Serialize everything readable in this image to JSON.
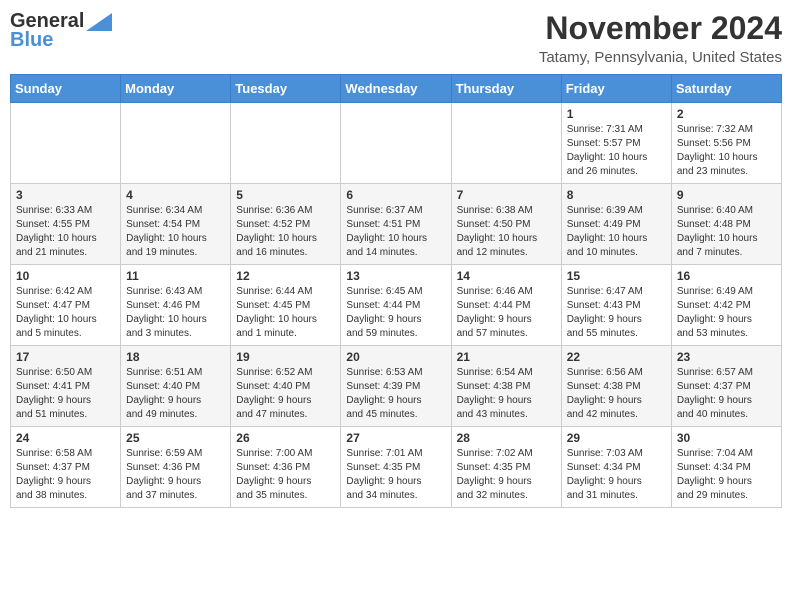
{
  "header": {
    "logo_line1": "General",
    "logo_line2": "Blue",
    "month": "November 2024",
    "location": "Tatamy, Pennsylvania, United States"
  },
  "days_of_week": [
    "Sunday",
    "Monday",
    "Tuesday",
    "Wednesday",
    "Thursday",
    "Friday",
    "Saturday"
  ],
  "weeks": [
    [
      {
        "day": "",
        "info": ""
      },
      {
        "day": "",
        "info": ""
      },
      {
        "day": "",
        "info": ""
      },
      {
        "day": "",
        "info": ""
      },
      {
        "day": "",
        "info": ""
      },
      {
        "day": "1",
        "info": "Sunrise: 7:31 AM\nSunset: 5:57 PM\nDaylight: 10 hours\nand 26 minutes."
      },
      {
        "day": "2",
        "info": "Sunrise: 7:32 AM\nSunset: 5:56 PM\nDaylight: 10 hours\nand 23 minutes."
      }
    ],
    [
      {
        "day": "3",
        "info": "Sunrise: 6:33 AM\nSunset: 4:55 PM\nDaylight: 10 hours\nand 21 minutes."
      },
      {
        "day": "4",
        "info": "Sunrise: 6:34 AM\nSunset: 4:54 PM\nDaylight: 10 hours\nand 19 minutes."
      },
      {
        "day": "5",
        "info": "Sunrise: 6:36 AM\nSunset: 4:52 PM\nDaylight: 10 hours\nand 16 minutes."
      },
      {
        "day": "6",
        "info": "Sunrise: 6:37 AM\nSunset: 4:51 PM\nDaylight: 10 hours\nand 14 minutes."
      },
      {
        "day": "7",
        "info": "Sunrise: 6:38 AM\nSunset: 4:50 PM\nDaylight: 10 hours\nand 12 minutes."
      },
      {
        "day": "8",
        "info": "Sunrise: 6:39 AM\nSunset: 4:49 PM\nDaylight: 10 hours\nand 10 minutes."
      },
      {
        "day": "9",
        "info": "Sunrise: 6:40 AM\nSunset: 4:48 PM\nDaylight: 10 hours\nand 7 minutes."
      }
    ],
    [
      {
        "day": "10",
        "info": "Sunrise: 6:42 AM\nSunset: 4:47 PM\nDaylight: 10 hours\nand 5 minutes."
      },
      {
        "day": "11",
        "info": "Sunrise: 6:43 AM\nSunset: 4:46 PM\nDaylight: 10 hours\nand 3 minutes."
      },
      {
        "day": "12",
        "info": "Sunrise: 6:44 AM\nSunset: 4:45 PM\nDaylight: 10 hours\nand 1 minute."
      },
      {
        "day": "13",
        "info": "Sunrise: 6:45 AM\nSunset: 4:44 PM\nDaylight: 9 hours\nand 59 minutes."
      },
      {
        "day": "14",
        "info": "Sunrise: 6:46 AM\nSunset: 4:44 PM\nDaylight: 9 hours\nand 57 minutes."
      },
      {
        "day": "15",
        "info": "Sunrise: 6:47 AM\nSunset: 4:43 PM\nDaylight: 9 hours\nand 55 minutes."
      },
      {
        "day": "16",
        "info": "Sunrise: 6:49 AM\nSunset: 4:42 PM\nDaylight: 9 hours\nand 53 minutes."
      }
    ],
    [
      {
        "day": "17",
        "info": "Sunrise: 6:50 AM\nSunset: 4:41 PM\nDaylight: 9 hours\nand 51 minutes."
      },
      {
        "day": "18",
        "info": "Sunrise: 6:51 AM\nSunset: 4:40 PM\nDaylight: 9 hours\nand 49 minutes."
      },
      {
        "day": "19",
        "info": "Sunrise: 6:52 AM\nSunset: 4:40 PM\nDaylight: 9 hours\nand 47 minutes."
      },
      {
        "day": "20",
        "info": "Sunrise: 6:53 AM\nSunset: 4:39 PM\nDaylight: 9 hours\nand 45 minutes."
      },
      {
        "day": "21",
        "info": "Sunrise: 6:54 AM\nSunset: 4:38 PM\nDaylight: 9 hours\nand 43 minutes."
      },
      {
        "day": "22",
        "info": "Sunrise: 6:56 AM\nSunset: 4:38 PM\nDaylight: 9 hours\nand 42 minutes."
      },
      {
        "day": "23",
        "info": "Sunrise: 6:57 AM\nSunset: 4:37 PM\nDaylight: 9 hours\nand 40 minutes."
      }
    ],
    [
      {
        "day": "24",
        "info": "Sunrise: 6:58 AM\nSunset: 4:37 PM\nDaylight: 9 hours\nand 38 minutes."
      },
      {
        "day": "25",
        "info": "Sunrise: 6:59 AM\nSunset: 4:36 PM\nDaylight: 9 hours\nand 37 minutes."
      },
      {
        "day": "26",
        "info": "Sunrise: 7:00 AM\nSunset: 4:36 PM\nDaylight: 9 hours\nand 35 minutes."
      },
      {
        "day": "27",
        "info": "Sunrise: 7:01 AM\nSunset: 4:35 PM\nDaylight: 9 hours\nand 34 minutes."
      },
      {
        "day": "28",
        "info": "Sunrise: 7:02 AM\nSunset: 4:35 PM\nDaylight: 9 hours\nand 32 minutes."
      },
      {
        "day": "29",
        "info": "Sunrise: 7:03 AM\nSunset: 4:34 PM\nDaylight: 9 hours\nand 31 minutes."
      },
      {
        "day": "30",
        "info": "Sunrise: 7:04 AM\nSunset: 4:34 PM\nDaylight: 9 hours\nand 29 minutes."
      }
    ]
  ]
}
